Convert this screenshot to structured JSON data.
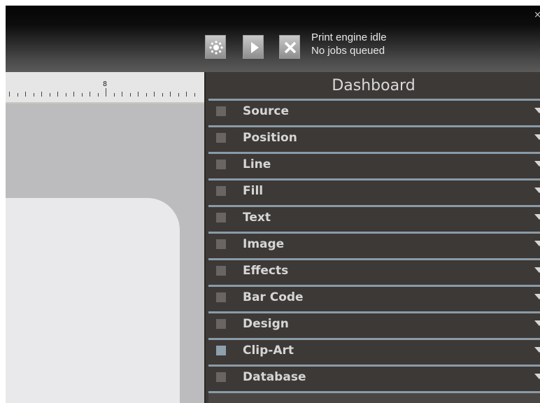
{
  "window": {
    "close_glyph": "×"
  },
  "toolbar": {
    "buttons": [
      {
        "name": "settings-gear-icon"
      },
      {
        "name": "play-icon"
      },
      {
        "name": "cancel-x-icon"
      }
    ],
    "status_line1": "Print engine idle",
    "status_line2": "No jobs queued"
  },
  "ruler": {
    "label": "8"
  },
  "dashboard": {
    "title": "Dashboard",
    "sections": [
      {
        "label": "Source",
        "active": false
      },
      {
        "label": "Position",
        "active": false
      },
      {
        "label": "Line",
        "active": false
      },
      {
        "label": "Fill",
        "active": false
      },
      {
        "label": "Text",
        "active": false
      },
      {
        "label": "Image",
        "active": false
      },
      {
        "label": "Effects",
        "active": false
      },
      {
        "label": "Bar Code",
        "active": false
      },
      {
        "label": "Design",
        "active": false
      },
      {
        "label": "Clip-Art",
        "active": true
      },
      {
        "label": "Database",
        "active": false
      }
    ]
  },
  "colors": {
    "panel_bg": "#3d3937",
    "section_divider": "#8a9ba6",
    "canvas_bg": "#bcbcbf",
    "page_bg": "#e9e9ec"
  }
}
